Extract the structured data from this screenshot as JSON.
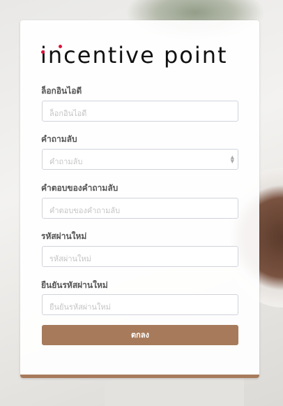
{
  "logo": {
    "text": "incentive point",
    "accent": "#e0103d"
  },
  "fields": [
    {
      "label": "ล็อกอินไอดี",
      "placeholder": "ล็อกอินไอดี"
    },
    {
      "label": "คำถามลับ",
      "placeholder": "คำถามลับ"
    },
    {
      "label": "คำตอบของคำถามลับ",
      "placeholder": "คำตอบของคำถามลับ"
    },
    {
      "label": "รหัสผ่านใหม่",
      "placeholder": "รหัสผ่านใหม่"
    },
    {
      "label": "ยืนยันรหัสผ่านใหม่",
      "placeholder": "ยืนยันรหัสผ่านใหม่"
    }
  ],
  "submit_label": "ตกลง",
  "colors": {
    "button": "#a67a5b"
  }
}
